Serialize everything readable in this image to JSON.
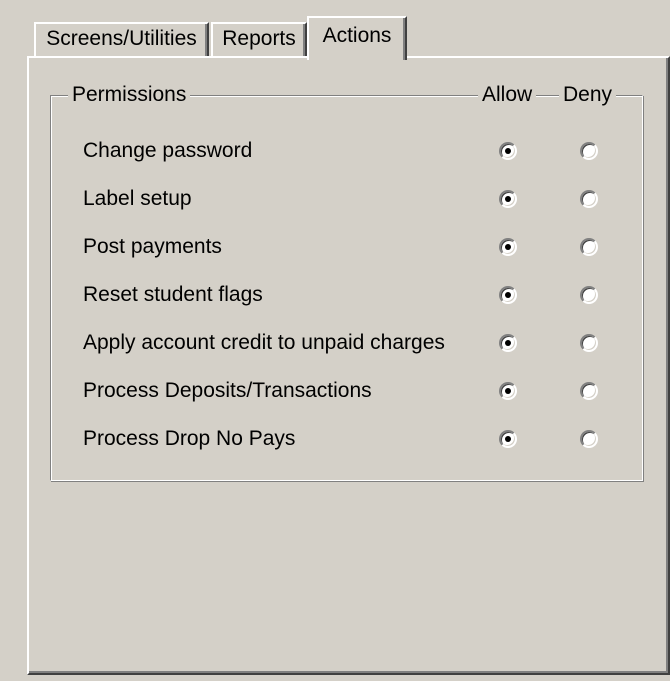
{
  "tabs": [
    {
      "label": "Screens/Utilities",
      "selected": false
    },
    {
      "label": "Reports",
      "selected": false
    },
    {
      "label": "Actions",
      "selected": true
    }
  ],
  "permissions": {
    "group_label": "Permissions",
    "allow_label": "Allow",
    "deny_label": "Deny",
    "rows": [
      {
        "label": "Change password",
        "value": "allow"
      },
      {
        "label": "Label setup",
        "value": "allow"
      },
      {
        "label": "Post payments",
        "value": "allow"
      },
      {
        "label": "Reset student flags",
        "value": "allow"
      },
      {
        "label": "Apply account credit to unpaid charges",
        "value": "allow"
      },
      {
        "label": "Process Deposits/Transactions",
        "value": "allow"
      },
      {
        "label": "Process Drop No Pays",
        "value": "allow"
      }
    ]
  }
}
